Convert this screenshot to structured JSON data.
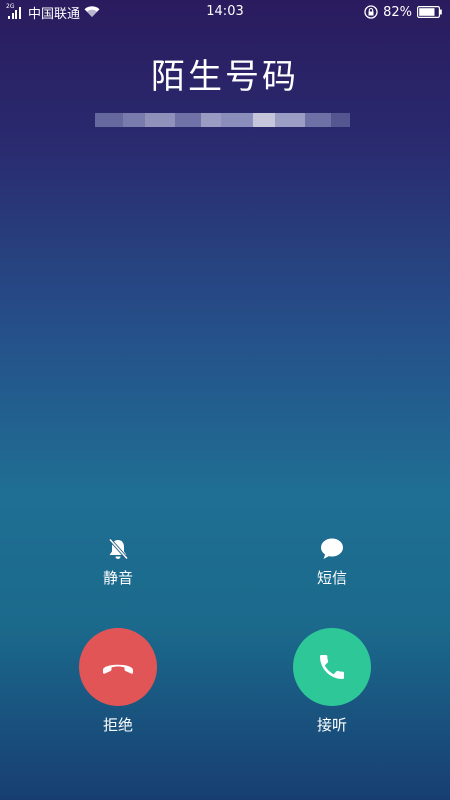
{
  "status_bar": {
    "network_type": "2G",
    "carrier": "中国联通",
    "time": "14:03",
    "battery_percent": "82%",
    "battery_level": 0.82,
    "icons": [
      "signal-icon",
      "wifi-icon",
      "rotation-lock-icon",
      "battery-icon"
    ]
  },
  "call": {
    "caller_name": "陌生号码",
    "number_redacted": true
  },
  "actions": {
    "mute_label": "静音",
    "sms_label": "短信",
    "decline_label": "拒绝",
    "answer_label": "接听"
  },
  "colors": {
    "decline": "#e25556",
    "answer": "#2ec798",
    "gradient_top": "#2a1b5e",
    "gradient_mid": "#1f6f94",
    "gradient_bottom": "#173e72"
  }
}
